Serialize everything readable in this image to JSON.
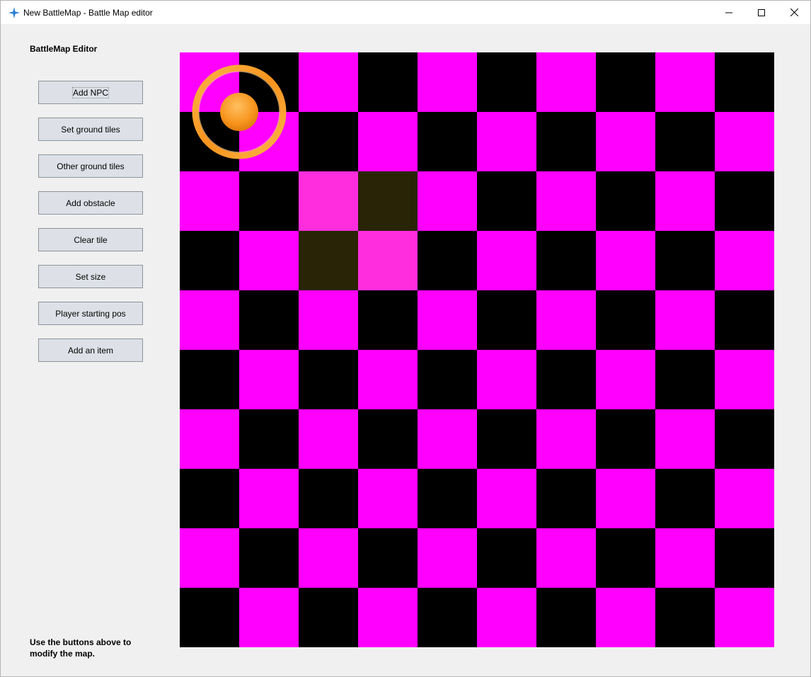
{
  "window": {
    "title": "New BattleMap - Battle Map editor",
    "icon": "app-star-icon",
    "controls": [
      "minimize-icon",
      "maximize-icon",
      "close-icon"
    ]
  },
  "sidebar": {
    "heading": "BattleMap Editor",
    "buttons": [
      {
        "label": "Add NPC",
        "name": "add-npc-button",
        "focused": true
      },
      {
        "label": "Set ground tiles",
        "name": "set-ground-tiles-button"
      },
      {
        "label": "Other ground tiles",
        "name": "other-ground-tiles-button"
      },
      {
        "label": "Add obstacle",
        "name": "add-obstacle-button"
      },
      {
        "label": "Clear tile",
        "name": "clear-tile-button"
      },
      {
        "label": "Set size",
        "name": "set-size-button"
      },
      {
        "label": "Player starting pos",
        "name": "player-starting-pos-button"
      },
      {
        "label": "Add an item",
        "name": "add-an-item-button"
      }
    ],
    "footer": "Use the buttons above to modify the map."
  },
  "map": {
    "columns": 10,
    "rows": 10,
    "colors": {
      "light": "#ff00ff",
      "dark": "#000000",
      "highlight_light": "#ff2ddd",
      "highlight_dark": "#2a2406"
    },
    "highlighted_tiles": [
      [
        2,
        2
      ],
      [
        3,
        2
      ],
      [
        2,
        3
      ],
      [
        3,
        3
      ]
    ],
    "player_marker": {
      "col": 0,
      "row": 0,
      "icon": "player-start-marker-icon",
      "color": "#f7941d"
    }
  }
}
